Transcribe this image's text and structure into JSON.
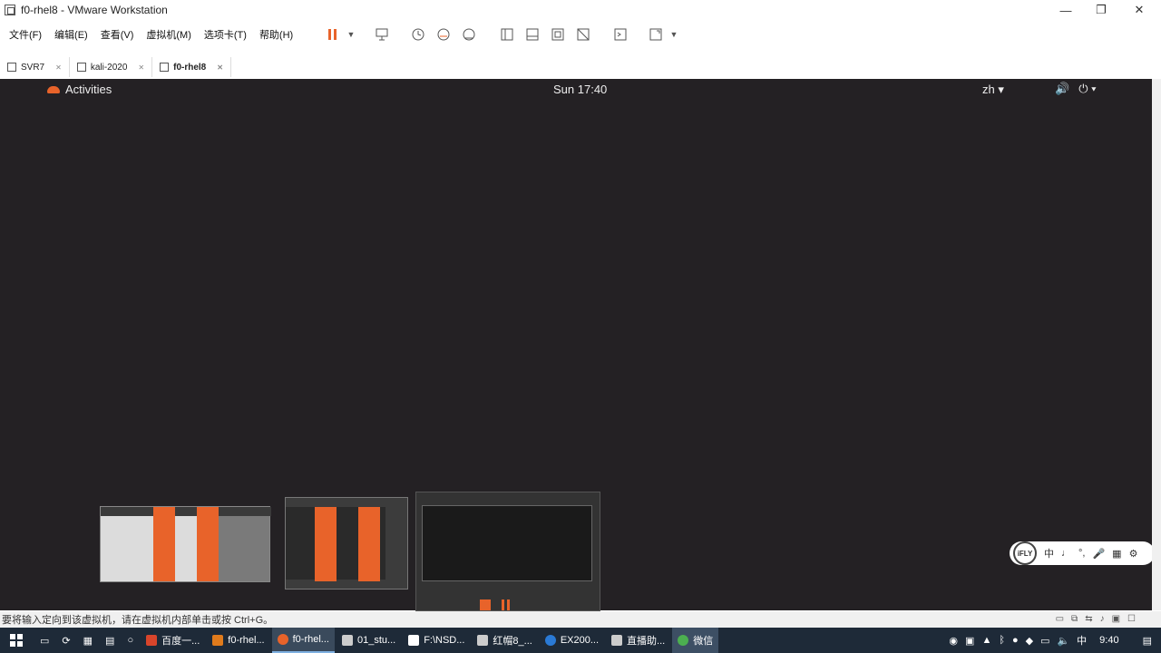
{
  "window": {
    "title": "f0-rhel8 - VMware Workstation",
    "min_icon": "minimize-icon",
    "max_icon": "maximize-icon",
    "close_icon": "close-icon",
    "min_glyph": "—",
    "max_glyph": "❐",
    "close_glyph": "✕"
  },
  "menu": [
    "文件(F)",
    "编辑(E)",
    "查看(V)",
    "虚拟机(M)",
    "选项卡(T)",
    "帮助(H)"
  ],
  "tabs": [
    {
      "label": "SVR7",
      "active": false
    },
    {
      "label": "kali-2020",
      "active": false
    },
    {
      "label": "f0-rhel8",
      "active": true
    }
  ],
  "guest": {
    "activities": "Activities",
    "clock": "Sun 17:40",
    "lang": "zh ▾",
    "volume_glyph": "🔊",
    "power_glyph": "⏻ ▾"
  },
  "ime": {
    "logo": "iFLY",
    "mode": "中"
  },
  "statusbar": {
    "text": "要将输入定向到该虚拟机，请在虚拟机内部单击或按 Ctrl+G。"
  },
  "taskbar": {
    "items": [
      {
        "label": "百度一...",
        "color": "#d9452b"
      },
      {
        "label": "f0-rhel...",
        "color": "#e07b1c"
      },
      {
        "label": "f0-rhel...",
        "color": "#e8632a",
        "active": true
      },
      {
        "label": "01_stu...",
        "color": "#cccccc"
      },
      {
        "label": "F:\\NSD...",
        "color": "#ffffff"
      },
      {
        "label": "红帽8_...",
        "color": "#cccccc"
      },
      {
        "label": "EX200...",
        "color": "#2a7ad6"
      },
      {
        "label": "直播助...",
        "color": "#cccccc"
      },
      {
        "label": "微信",
        "color": "#4caf50"
      }
    ],
    "time": "9:40"
  },
  "colors": {
    "vm_background": "#242124",
    "accent": "#e8632a",
    "taskbar": "#1e2a38"
  }
}
